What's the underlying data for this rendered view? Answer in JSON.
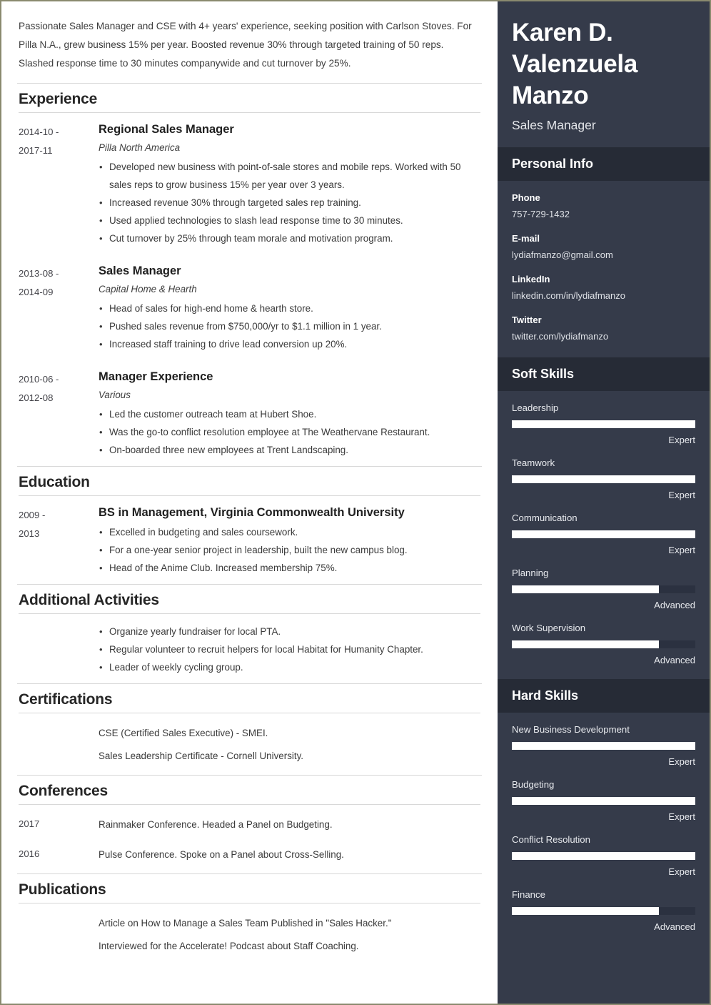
{
  "theme": {
    "page_border": "#8a8a6e",
    "sidebar_bg": "#353b4a",
    "sidebar_header_bg": "#262b36",
    "bar_track": "#2b3140",
    "bar_fill": "#ffffff",
    "rule": "#d8d8d8"
  },
  "summary": "Passionate Sales Manager and CSE with 4+ years' experience, seeking position with Carlson Stoves. For Pilla N.A., grew business 15% per year. Boosted revenue 30% through targeted training of 50 reps. Slashed response time to 30 minutes companywide and cut turnover by 25%.",
  "sections": {
    "experience": {
      "title": "Experience",
      "entries": [
        {
          "dates_line1": "2014-10 -",
          "dates_line2": "2017-11",
          "title": "Regional Sales Manager",
          "org": "Pilla North America",
          "bullets": [
            "Developed new business with point-of-sale stores and mobile reps. Worked with 50 sales reps to grow business 15% per year over 3 years.",
            "Increased revenue 30% through targeted sales rep training.",
            "Used applied technologies to slash lead response time to 30 minutes.",
            "Cut turnover by 25% through team morale and motivation program."
          ]
        },
        {
          "dates_line1": "2013-08 -",
          "dates_line2": "2014-09",
          "title": "Sales Manager",
          "org": "Capital Home & Hearth",
          "bullets": [
            "Head of sales for high-end home & hearth store.",
            "Pushed sales revenue from $750,000/yr to $1.1 million in 1 year.",
            "Increased staff training to drive lead conversion up 20%."
          ]
        },
        {
          "dates_line1": "2010-06 -",
          "dates_line2": "2012-08",
          "title": "Manager Experience",
          "org": "Various",
          "bullets": [
            "Led the customer outreach team at Hubert Shoe.",
            "Was the go-to conflict resolution employee at The Weathervane Restaurant.",
            "On-boarded three new employees at Trent Landscaping."
          ]
        }
      ]
    },
    "education": {
      "title": "Education",
      "entries": [
        {
          "dates_line1": "2009 -",
          "dates_line2": "2013",
          "title": "BS in Management, Virginia Commonwealth University",
          "bullets": [
            "Excelled in budgeting and sales coursework.",
            "For a one-year senior project in leadership, built the new campus blog.",
            "Head of the Anime Club. Increased membership 75%."
          ]
        }
      ]
    },
    "additional_activities": {
      "title": "Additional Activities",
      "bullets": [
        "Organize yearly fundraiser for local PTA.",
        "Regular volunteer to recruit helpers for local Habitat for Humanity Chapter.",
        "Leader of weekly cycling group."
      ]
    },
    "certifications": {
      "title": "Certifications",
      "lines": [
        "CSE (Certified Sales Executive) - SMEI.",
        "Sales Leadership Certificate - Cornell University."
      ]
    },
    "conferences": {
      "title": "Conferences",
      "entries": [
        {
          "year": "2017",
          "text": "Rainmaker Conference. Headed a Panel on Budgeting."
        },
        {
          "year": "2016",
          "text": "Pulse Conference. Spoke on a Panel about Cross-Selling."
        }
      ]
    },
    "publications": {
      "title": "Publications",
      "lines": [
        "Article on How to Manage a Sales Team Published in \"Sales Hacker.\"",
        "Interviewed for the Accelerate! Podcast about Staff Coaching."
      ]
    }
  },
  "sidebar": {
    "name": "Karen D. Valenzuela Manzo",
    "job_title": "Sales Manager",
    "personal_info": {
      "title": "Personal Info",
      "items": [
        {
          "label": "Phone",
          "value": "757-729-1432"
        },
        {
          "label": "E-mail",
          "value": "lydiafmanzo@gmail.com"
        },
        {
          "label": "LinkedIn",
          "value": "linkedin.com/in/lydiafmanzo"
        },
        {
          "label": "Twitter",
          "value": "twitter.com/lydiafmanzo"
        }
      ]
    },
    "soft_skills": {
      "title": "Soft Skills",
      "items": [
        {
          "name": "Leadership",
          "level": "Expert",
          "percent": 100
        },
        {
          "name": "Teamwork",
          "level": "Expert",
          "percent": 100
        },
        {
          "name": "Communication",
          "level": "Expert",
          "percent": 100
        },
        {
          "name": "Planning",
          "level": "Advanced",
          "percent": 80
        },
        {
          "name": "Work Supervision",
          "level": "Advanced",
          "percent": 80
        }
      ]
    },
    "hard_skills": {
      "title": "Hard Skills",
      "items": [
        {
          "name": "New Business Development",
          "level": "Expert",
          "percent": 100
        },
        {
          "name": "Budgeting",
          "level": "Expert",
          "percent": 100
        },
        {
          "name": "Conflict Resolution",
          "level": "Expert",
          "percent": 100
        },
        {
          "name": "Finance",
          "level": "Advanced",
          "percent": 80
        }
      ]
    }
  }
}
